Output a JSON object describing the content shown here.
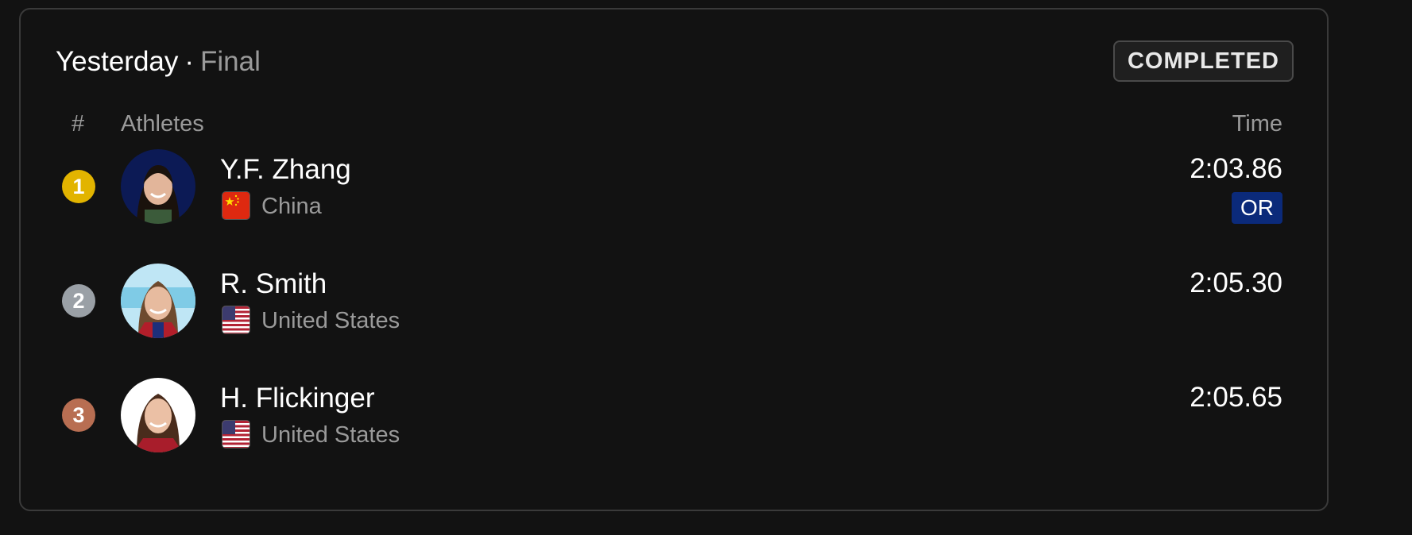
{
  "header": {
    "day": "Yesterday",
    "separator": "·",
    "phase": "Final"
  },
  "status": {
    "label": "COMPLETED"
  },
  "columns": {
    "rank": "#",
    "athletes": "Athletes",
    "time": "Time"
  },
  "colors": {
    "gold": "#e2b400",
    "silver": "#9aa0a6",
    "bronze": "#b86e52",
    "record_badge": "#0b2a7a"
  },
  "results": [
    {
      "rank": "1",
      "medal": "gold",
      "name": "Y.F. Zhang",
      "country": "China",
      "flag_icon": "china-flag-icon",
      "time": "2:03.86",
      "record": "OR"
    },
    {
      "rank": "2",
      "medal": "silver",
      "name": "R. Smith",
      "country": "United States",
      "flag_icon": "usa-flag-icon",
      "time": "2:05.30"
    },
    {
      "rank": "3",
      "medal": "bronze",
      "name": "H. Flickinger",
      "country": "United States",
      "flag_icon": "usa-flag-icon",
      "time": "2:05.65"
    }
  ]
}
